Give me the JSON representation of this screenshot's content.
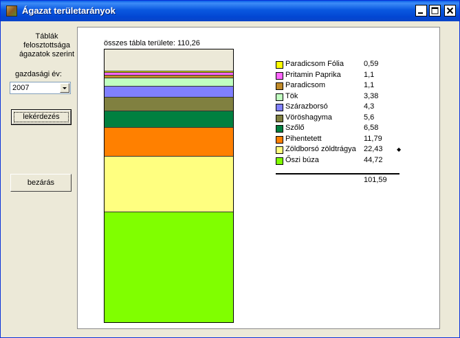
{
  "window": {
    "title": "Ágazat területarányok"
  },
  "sidebar": {
    "tables_label": "Táblák\nfelosztottsága\nágazatok szerint",
    "year_label": "gazdasági év:",
    "year_value": "2007",
    "query_button": "lekérdezés",
    "close_button": "bezárás"
  },
  "chart_data": {
    "type": "bar",
    "title": "összes tábla területe: 110,26",
    "total_area": 110.26,
    "series": [
      {
        "name": "Paradicsom Fólia",
        "value": 0.59,
        "value_label": "0,59",
        "color": "#ffff00"
      },
      {
        "name": "Pritamin Paprika",
        "value": 1.1,
        "value_label": "1,1",
        "color": "#ff66ff"
      },
      {
        "name": "Paradicsom",
        "value": 1.1,
        "value_label": "1,1",
        "color": "#c08a2a"
      },
      {
        "name": "Tök",
        "value": 3.38,
        "value_label": "3,38",
        "color": "#c0ffc0"
      },
      {
        "name": "Szárazborsó",
        "value": 4.3,
        "value_label": "4,3",
        "color": "#8080ff"
      },
      {
        "name": "Vöröshagyma",
        "value": 5.6,
        "value_label": "5,6",
        "color": "#808040"
      },
      {
        "name": "Szőlő",
        "value": 6.58,
        "value_label": "6,58",
        "color": "#008040"
      },
      {
        "name": "Pihentetett",
        "value": 11.79,
        "value_label": "11,79",
        "color": "#ff8000"
      },
      {
        "name": "Zöldborsó zöldtrágya",
        "value": 22.43,
        "value_label": "22,43",
        "color": "#ffff80",
        "marked": true
      },
      {
        "name": "Őszi búza",
        "value": 44.72,
        "value_label": "44,72",
        "color": "#80ff00"
      }
    ],
    "sum_label": "101,59",
    "marker_symbol": "◆"
  }
}
